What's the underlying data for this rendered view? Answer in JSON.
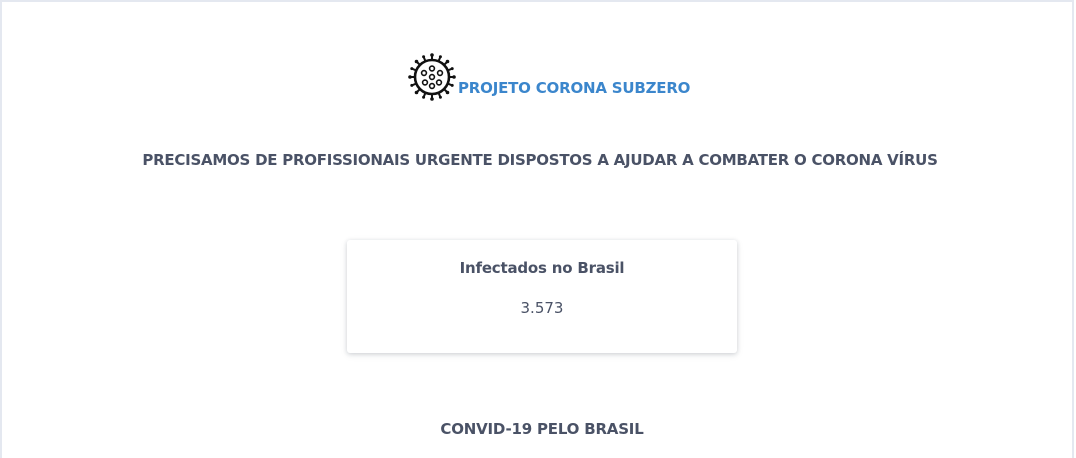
{
  "header": {
    "brand_text": "PROJETO CORONA SUBZERO",
    "brand_icon": "virus-icon"
  },
  "main": {
    "headline": "PRECISAMOS DE PROFISSIONAIS URGENTE DISPOSTOS A AJUDAR A COMBATER O CORONA VÍRUS",
    "stat_card": {
      "title": "Infectados no Brasil",
      "value": "3.573"
    },
    "section_title": "CONVID-19 PELO BRASIL"
  },
  "colors": {
    "brand": "#3b86cc",
    "text": "#4a5266",
    "border": "#e4e8f0",
    "background": "#ffffff"
  }
}
